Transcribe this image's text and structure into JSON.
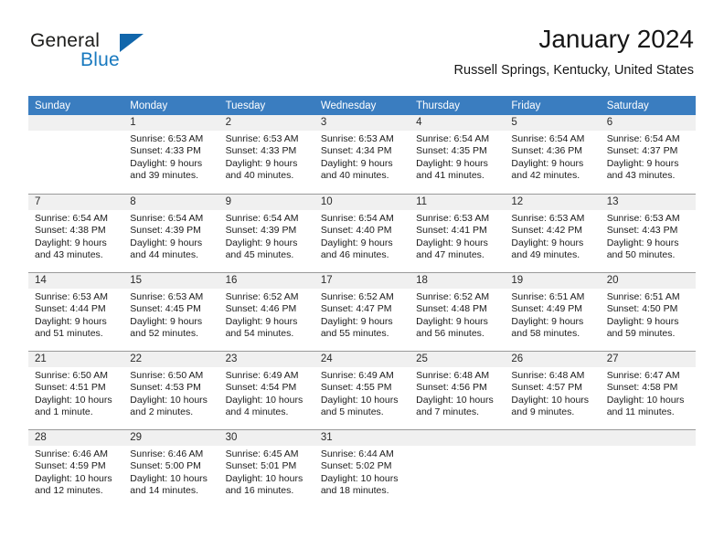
{
  "brand": {
    "name_part1": "General",
    "name_part2": "Blue",
    "logo_colors": {
      "dark": "#1d1d1b",
      "blue": "#1879bf",
      "triangle": "#1166ab"
    }
  },
  "header": {
    "month_title": "January 2024",
    "location": "Russell Springs, Kentucky, United States"
  },
  "theme": {
    "header_row_bg": "#3a7dc0",
    "daynum_bg": "#f0f0f0",
    "grid_line": "#9a9a9a"
  },
  "weekday_headers": [
    "Sunday",
    "Monday",
    "Tuesday",
    "Wednesday",
    "Thursday",
    "Friday",
    "Saturday"
  ],
  "weeks": [
    [
      {
        "day": ""
      },
      {
        "day": "1",
        "sunrise": "Sunrise: 6:53 AM",
        "sunset": "Sunset: 4:33 PM",
        "daylight1": "Daylight: 9 hours",
        "daylight2": "and 39 minutes."
      },
      {
        "day": "2",
        "sunrise": "Sunrise: 6:53 AM",
        "sunset": "Sunset: 4:33 PM",
        "daylight1": "Daylight: 9 hours",
        "daylight2": "and 40 minutes."
      },
      {
        "day": "3",
        "sunrise": "Sunrise: 6:53 AM",
        "sunset": "Sunset: 4:34 PM",
        "daylight1": "Daylight: 9 hours",
        "daylight2": "and 40 minutes."
      },
      {
        "day": "4",
        "sunrise": "Sunrise: 6:54 AM",
        "sunset": "Sunset: 4:35 PM",
        "daylight1": "Daylight: 9 hours",
        "daylight2": "and 41 minutes."
      },
      {
        "day": "5",
        "sunrise": "Sunrise: 6:54 AM",
        "sunset": "Sunset: 4:36 PM",
        "daylight1": "Daylight: 9 hours",
        "daylight2": "and 42 minutes."
      },
      {
        "day": "6",
        "sunrise": "Sunrise: 6:54 AM",
        "sunset": "Sunset: 4:37 PM",
        "daylight1": "Daylight: 9 hours",
        "daylight2": "and 43 minutes."
      }
    ],
    [
      {
        "day": "7",
        "sunrise": "Sunrise: 6:54 AM",
        "sunset": "Sunset: 4:38 PM",
        "daylight1": "Daylight: 9 hours",
        "daylight2": "and 43 minutes."
      },
      {
        "day": "8",
        "sunrise": "Sunrise: 6:54 AM",
        "sunset": "Sunset: 4:39 PM",
        "daylight1": "Daylight: 9 hours",
        "daylight2": "and 44 minutes."
      },
      {
        "day": "9",
        "sunrise": "Sunrise: 6:54 AM",
        "sunset": "Sunset: 4:39 PM",
        "daylight1": "Daylight: 9 hours",
        "daylight2": "and 45 minutes."
      },
      {
        "day": "10",
        "sunrise": "Sunrise: 6:54 AM",
        "sunset": "Sunset: 4:40 PM",
        "daylight1": "Daylight: 9 hours",
        "daylight2": "and 46 minutes."
      },
      {
        "day": "11",
        "sunrise": "Sunrise: 6:53 AM",
        "sunset": "Sunset: 4:41 PM",
        "daylight1": "Daylight: 9 hours",
        "daylight2": "and 47 minutes."
      },
      {
        "day": "12",
        "sunrise": "Sunrise: 6:53 AM",
        "sunset": "Sunset: 4:42 PM",
        "daylight1": "Daylight: 9 hours",
        "daylight2": "and 49 minutes."
      },
      {
        "day": "13",
        "sunrise": "Sunrise: 6:53 AM",
        "sunset": "Sunset: 4:43 PM",
        "daylight1": "Daylight: 9 hours",
        "daylight2": "and 50 minutes."
      }
    ],
    [
      {
        "day": "14",
        "sunrise": "Sunrise: 6:53 AM",
        "sunset": "Sunset: 4:44 PM",
        "daylight1": "Daylight: 9 hours",
        "daylight2": "and 51 minutes."
      },
      {
        "day": "15",
        "sunrise": "Sunrise: 6:53 AM",
        "sunset": "Sunset: 4:45 PM",
        "daylight1": "Daylight: 9 hours",
        "daylight2": "and 52 minutes."
      },
      {
        "day": "16",
        "sunrise": "Sunrise: 6:52 AM",
        "sunset": "Sunset: 4:46 PM",
        "daylight1": "Daylight: 9 hours",
        "daylight2": "and 54 minutes."
      },
      {
        "day": "17",
        "sunrise": "Sunrise: 6:52 AM",
        "sunset": "Sunset: 4:47 PM",
        "daylight1": "Daylight: 9 hours",
        "daylight2": "and 55 minutes."
      },
      {
        "day": "18",
        "sunrise": "Sunrise: 6:52 AM",
        "sunset": "Sunset: 4:48 PM",
        "daylight1": "Daylight: 9 hours",
        "daylight2": "and 56 minutes."
      },
      {
        "day": "19",
        "sunrise": "Sunrise: 6:51 AM",
        "sunset": "Sunset: 4:49 PM",
        "daylight1": "Daylight: 9 hours",
        "daylight2": "and 58 minutes."
      },
      {
        "day": "20",
        "sunrise": "Sunrise: 6:51 AM",
        "sunset": "Sunset: 4:50 PM",
        "daylight1": "Daylight: 9 hours",
        "daylight2": "and 59 minutes."
      }
    ],
    [
      {
        "day": "21",
        "sunrise": "Sunrise: 6:50 AM",
        "sunset": "Sunset: 4:51 PM",
        "daylight1": "Daylight: 10 hours",
        "daylight2": "and 1 minute."
      },
      {
        "day": "22",
        "sunrise": "Sunrise: 6:50 AM",
        "sunset": "Sunset: 4:53 PM",
        "daylight1": "Daylight: 10 hours",
        "daylight2": "and 2 minutes."
      },
      {
        "day": "23",
        "sunrise": "Sunrise: 6:49 AM",
        "sunset": "Sunset: 4:54 PM",
        "daylight1": "Daylight: 10 hours",
        "daylight2": "and 4 minutes."
      },
      {
        "day": "24",
        "sunrise": "Sunrise: 6:49 AM",
        "sunset": "Sunset: 4:55 PM",
        "daylight1": "Daylight: 10 hours",
        "daylight2": "and 5 minutes."
      },
      {
        "day": "25",
        "sunrise": "Sunrise: 6:48 AM",
        "sunset": "Sunset: 4:56 PM",
        "daylight1": "Daylight: 10 hours",
        "daylight2": "and 7 minutes."
      },
      {
        "day": "26",
        "sunrise": "Sunrise: 6:48 AM",
        "sunset": "Sunset: 4:57 PM",
        "daylight1": "Daylight: 10 hours",
        "daylight2": "and 9 minutes."
      },
      {
        "day": "27",
        "sunrise": "Sunrise: 6:47 AM",
        "sunset": "Sunset: 4:58 PM",
        "daylight1": "Daylight: 10 hours",
        "daylight2": "and 11 minutes."
      }
    ],
    [
      {
        "day": "28",
        "sunrise": "Sunrise: 6:46 AM",
        "sunset": "Sunset: 4:59 PM",
        "daylight1": "Daylight: 10 hours",
        "daylight2": "and 12 minutes."
      },
      {
        "day": "29",
        "sunrise": "Sunrise: 6:46 AM",
        "sunset": "Sunset: 5:00 PM",
        "daylight1": "Daylight: 10 hours",
        "daylight2": "and 14 minutes."
      },
      {
        "day": "30",
        "sunrise": "Sunrise: 6:45 AM",
        "sunset": "Sunset: 5:01 PM",
        "daylight1": "Daylight: 10 hours",
        "daylight2": "and 16 minutes."
      },
      {
        "day": "31",
        "sunrise": "Sunrise: 6:44 AM",
        "sunset": "Sunset: 5:02 PM",
        "daylight1": "Daylight: 10 hours",
        "daylight2": "and 18 minutes."
      },
      {
        "day": ""
      },
      {
        "day": ""
      },
      {
        "day": ""
      }
    ]
  ]
}
